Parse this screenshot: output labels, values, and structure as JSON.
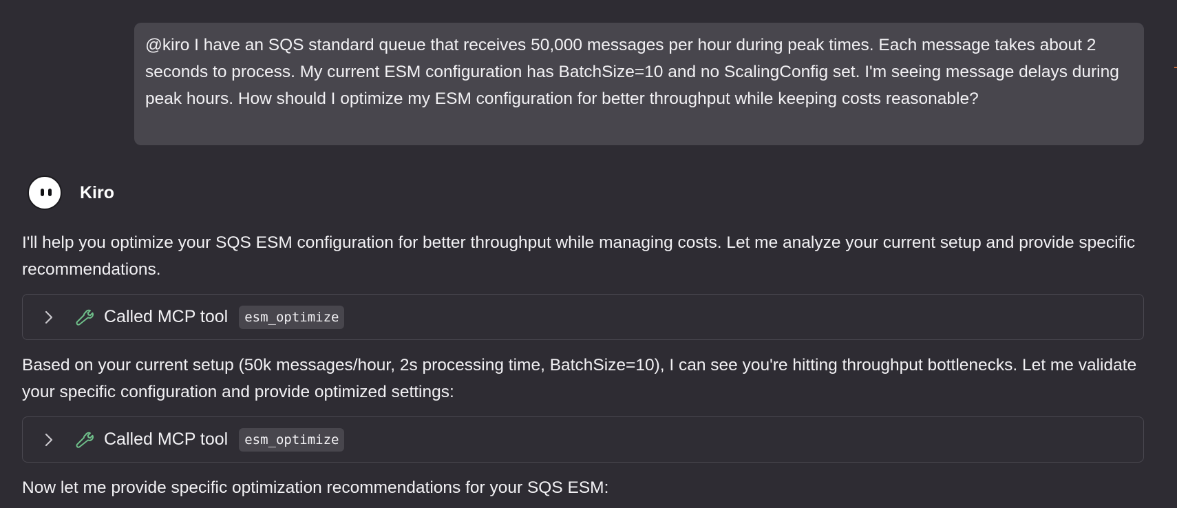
{
  "user_message": {
    "text": "@kiro I have an SQS standard queue that receives 50,000 messages per hour during peak times. Each message takes about 2 seconds to process. My current ESM configuration has BatchSize=10 and no ScalingConfig set. I'm seeing message delays during peak hours. How should I optimize my ESM configuration for better throughput while keeping costs reasonable?"
  },
  "assistant": {
    "name": "Kiro",
    "paragraphs": [
      "I'll help you optimize your SQS ESM configuration for better throughput while managing costs. Let me analyze your current setup and provide specific recommendations.",
      "Based on your current setup (50k messages/hour, 2s processing time, BatchSize=10), I can see you're hitting throughput bottlenecks. Let me validate your specific configuration and provide optimized settings:",
      "Now let me provide specific optimization recommendations for your SQS ESM:"
    ],
    "tool_calls": [
      {
        "label": "Called MCP tool",
        "tool": "esm_optimize",
        "icon": "wrench-icon",
        "expand_icon": "chevron-right-icon"
      },
      {
        "label": "Called MCP tool",
        "tool": "esm_optimize",
        "icon": "wrench-icon",
        "expand_icon": "chevron-right-icon"
      }
    ]
  },
  "colors": {
    "background": "#2e2c33",
    "user_bubble": "#48464d",
    "tool_icon": "#6fbf8a"
  }
}
